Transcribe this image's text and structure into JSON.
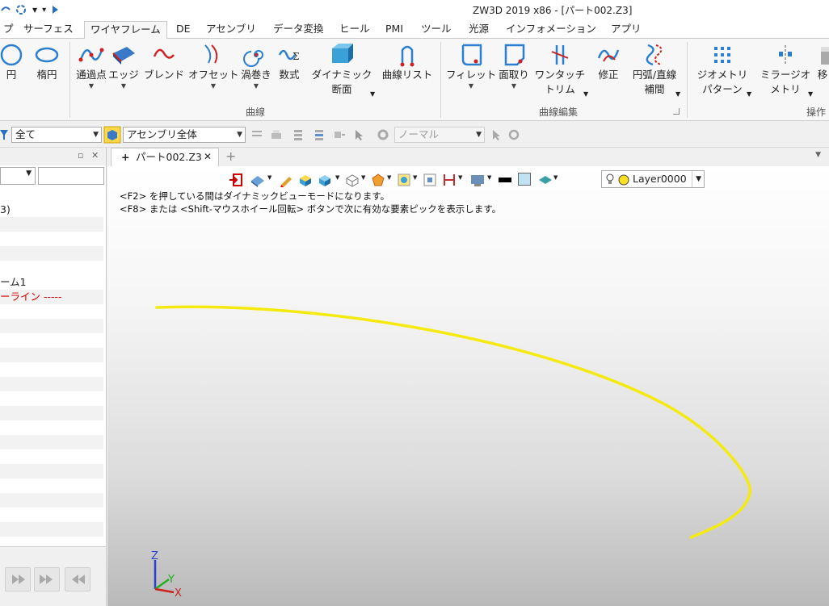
{
  "window": {
    "title": "ZW3D 2019  x86 - [パート002.Z3]"
  },
  "tabs": [
    {
      "label": "プ",
      "active": false
    },
    {
      "label": "サーフェス",
      "active": false
    },
    {
      "label": "ワイヤフレーム",
      "active": true
    },
    {
      "label": "DE",
      "active": false
    },
    {
      "label": "アセンブリ",
      "active": false
    },
    {
      "label": "データ変換",
      "active": false
    },
    {
      "label": "ヒール",
      "active": false
    },
    {
      "label": "PMI",
      "active": false
    },
    {
      "label": "ツール",
      "active": false
    },
    {
      "label": "光源",
      "active": false
    },
    {
      "label": "インフォメーション",
      "active": false
    },
    {
      "label": "アプリ",
      "active": false
    }
  ],
  "ribbon": {
    "buttons": [
      {
        "id": "circle",
        "label": "円"
      },
      {
        "id": "ellipse",
        "label": "楕円"
      },
      {
        "id": "through-points",
        "label": "通過点"
      },
      {
        "id": "edge",
        "label": "エッジ"
      },
      {
        "id": "blend",
        "label": "ブレンド"
      },
      {
        "id": "offset",
        "label": "オフセット"
      },
      {
        "id": "spiral",
        "label": "渦巻き"
      },
      {
        "id": "formula",
        "label": "数式"
      },
      {
        "id": "dynamic-section",
        "label": "ダイナミック",
        "label2": "断面"
      },
      {
        "id": "curve-list",
        "label": "曲線リスト"
      },
      {
        "id": "fillet",
        "label": "フィレット"
      },
      {
        "id": "chamfer",
        "label": "面取り"
      },
      {
        "id": "one-touch-trim",
        "label": "ワンタッチ",
        "label2": "トリム"
      },
      {
        "id": "modify",
        "label": "修正"
      },
      {
        "id": "arc-line-interp",
        "label": "円弧/直線",
        "label2": "補間"
      },
      {
        "id": "geometry-pattern",
        "label": "ジオメトリ",
        "label2": "パターン"
      },
      {
        "id": "mirror-geometry",
        "label": "ミラージオ",
        "label2": "メトリ"
      },
      {
        "id": "move",
        "label": "移"
      }
    ],
    "groups": {
      "curve": "曲線",
      "curve_edit": "曲線編集",
      "operation": "操作"
    }
  },
  "toolbar": {
    "filter_value": "全て",
    "scope_value": "アセンブリ全体",
    "mode_value": "ノーマル"
  },
  "leftpanel": {
    "rows": [
      {
        "text": "3)",
        "color": "#222222"
      },
      {
        "text": "",
        "color": "#222222"
      },
      {
        "text": "",
        "color": "#222222"
      },
      {
        "text": "",
        "color": "#222222"
      },
      {
        "text": "",
        "color": "#222222"
      },
      {
        "text": "ーム1",
        "color": "#222222"
      },
      {
        "text": "ーライン -----",
        "color": "#d00000"
      }
    ]
  },
  "document": {
    "tab_label": "パート002.Z3",
    "close_glyph": "✕",
    "new_tab_glyph": "+"
  },
  "viewport": {
    "hint1": "<F2> を押している間はダイナミックビューモードになります。",
    "hint2": "<F8> または <Shift-マウスホイール回転> ボタンで次に有効な要素ピックを表示します。",
    "layer": "Layer0000",
    "axes": {
      "z": "Z",
      "y": "Y",
      "x": "X"
    },
    "curve_color": "#f5ea10"
  }
}
